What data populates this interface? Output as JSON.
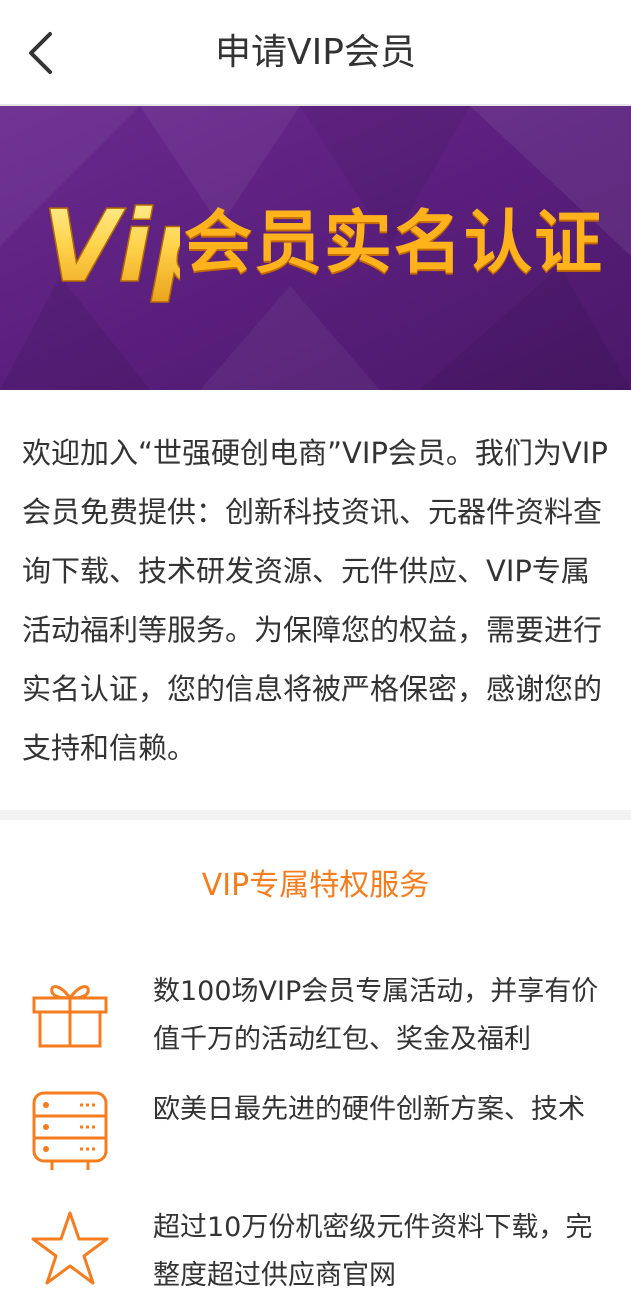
{
  "header": {
    "title": "申请VIP会员"
  },
  "banner": {
    "logo_text": "Vip",
    "title": "会员实名认证"
  },
  "intro": {
    "text": "欢迎加入“世强硬创电商”VIP会员。我们为VIP会员免费提供：创新科技资讯、元器件资料查询下载、技术研发资源、元件供应、VIP专属活动福利等服务。为保障您的权益，需要进行实名认证，您的信息将被严格保密，感谢您的支持和信赖。"
  },
  "privileges": {
    "title": "VIP专属特权服务",
    "items": [
      {
        "icon": "gift-icon",
        "text": "数100场VIP会员专属活动，并享有价值千万的活动红包、奖金及福利"
      },
      {
        "icon": "server-icon",
        "text": "欧美日最先进的硬件创新方案、技术"
      },
      {
        "icon": "star-icon",
        "text": "超过10万份机密级元件资料下载，完整度超过供应商官网"
      }
    ]
  },
  "colors": {
    "accent": "#f57c1f",
    "banner": "#5a1f7d",
    "gold": "#ffb21c"
  }
}
